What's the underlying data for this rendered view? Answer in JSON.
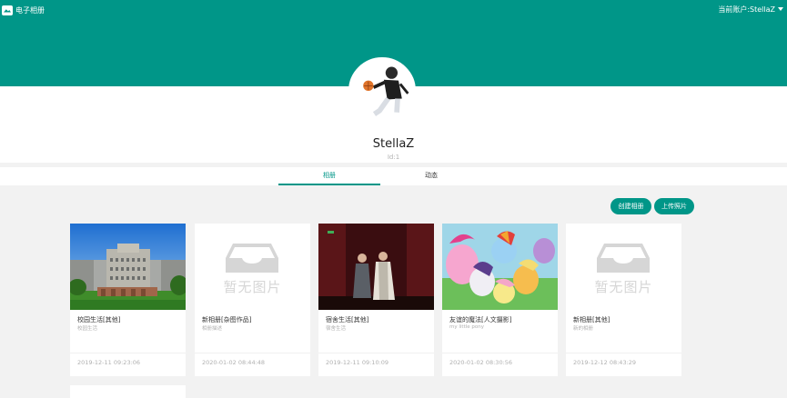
{
  "app": {
    "title": "电子相册",
    "account_label": "当前账户:StellaZ"
  },
  "profile": {
    "username": "StellaZ",
    "user_id": "Id:1"
  },
  "tabs": [
    {
      "label": "相册",
      "active": true
    },
    {
      "label": "动态",
      "active": false
    }
  ],
  "actions": {
    "create_album": "创建相册",
    "upload_photo": "上传照片"
  },
  "placeholder_text": "暂无图片",
  "albums": [
    {
      "title": "校园生活[其他]",
      "description": "校园生活",
      "date": "2019-12-11 09:23:06",
      "has_cover": true,
      "cover": "campus"
    },
    {
      "title": "新相册[杂图作品]",
      "description": "相册描述",
      "date": "2020-01-02 08:44:48",
      "has_cover": false
    },
    {
      "title": "宿舍生活[其他]",
      "description": "宿舍生活",
      "date": "2019-12-11 09:10:09",
      "has_cover": true,
      "cover": "stage"
    },
    {
      "title": "友谊的魔法[人文摄影]",
      "description": "my little pony",
      "date": "2020-01-02 08:30:56",
      "has_cover": true,
      "cover": "pony"
    },
    {
      "title": "新相册[其他]",
      "description": "新的相册",
      "date": "2019-12-12 08:43:29",
      "has_cover": false
    }
  ],
  "colors": {
    "primary": "#009688",
    "page_background": "#f2f2f2",
    "muted_text": "#b0b0b0",
    "placeholder": "#d6d6d6"
  },
  "icons": {
    "logo": "photo-album-icon",
    "account_menu": "caret-down-icon",
    "empty_album": "empty-tray-icon"
  }
}
